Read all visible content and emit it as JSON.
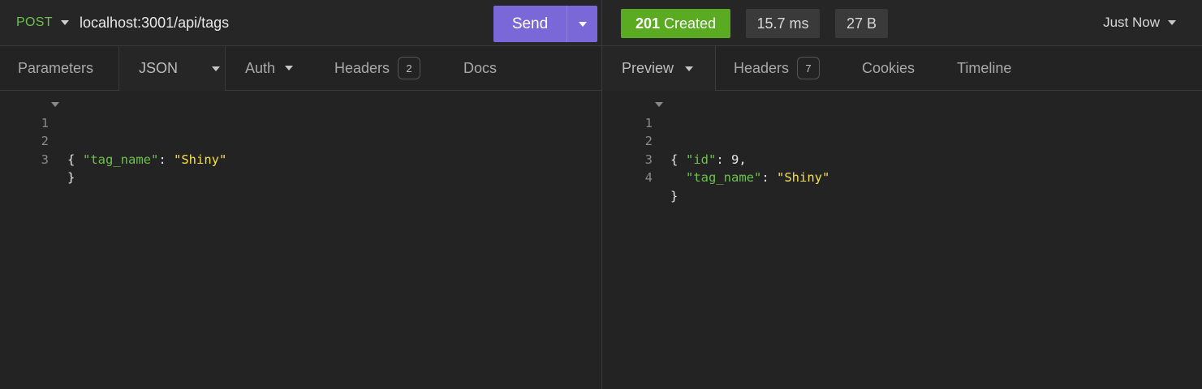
{
  "request": {
    "method": "POST",
    "url": "localhost:3001/api/tags",
    "send_label": "Send",
    "tabs": {
      "parameters": "Parameters",
      "json": "JSON",
      "auth": "Auth",
      "headers": "Headers",
      "headers_count": "2",
      "docs": "Docs"
    },
    "body": {
      "line_numbers": [
        "1",
        "2",
        "3"
      ],
      "open_brace": "{",
      "key": "\"tag_name\"",
      "colon": ": ",
      "value": "\"Shiny\"",
      "close_brace": "}"
    }
  },
  "response": {
    "status": "201 Created",
    "status_code": "201",
    "status_text": "Created",
    "time": "15.7 ms",
    "size": "27 B",
    "history": "Just Now",
    "tabs": {
      "preview": "Preview",
      "headers": "Headers",
      "headers_count": "7",
      "cookies": "Cookies",
      "timeline": "Timeline"
    },
    "body": {
      "line_numbers": [
        "1",
        "2",
        "3",
        "4"
      ],
      "open_brace": "{",
      "id_key": "\"id\"",
      "id_colon": ": ",
      "id_value": "9",
      "comma": ",",
      "tag_key": "\"tag_name\"",
      "tag_colon": ": ",
      "tag_value": "\"Shiny\"",
      "close_brace": "}"
    }
  },
  "colors": {
    "background": "#232323",
    "method": "#6cc24a",
    "send": "#7b68d8",
    "status_success": "#5aab21",
    "json_key": "#6cc24a",
    "json_string": "#f5e04a"
  },
  "icons": {
    "method_dropdown": "caret-down-icon",
    "send_dropdown": "caret-down-icon",
    "fold": "fold-caret-icon"
  }
}
